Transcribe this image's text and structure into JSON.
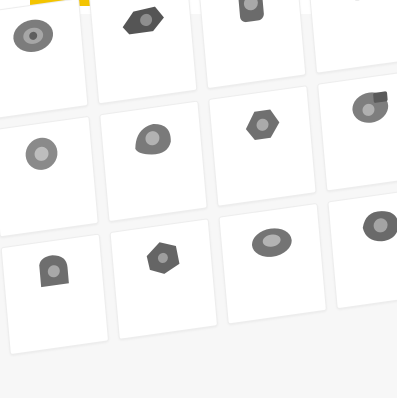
{
  "colors": {
    "accent": "#f3c400",
    "code_text": "#2b3b6c",
    "badge_text": "#2f8a2f",
    "badge_bg": "#e9f6e9",
    "desc_text": "#8a8a8a"
  },
  "products": [
    {
      "badge": "",
      "code": "",
      "desc": "",
      "button": "",
      "icon": "turbo-part-icon"
    },
    {
      "badge": "",
      "code": "",
      "desc": "",
      "button": "",
      "icon": "turbo-part-icon"
    },
    {
      "badge": "",
      "code": "",
      "desc": "",
      "button": "",
      "icon": "turbo-part-icon"
    },
    {
      "badge": "",
      "code": "",
      "desc": "",
      "button": "",
      "icon": "turbo-part-icon"
    },
    {
      "badge": "",
      "code": "",
      "desc": "",
      "button": "",
      "icon": "turbo-part-icon"
    },
    {
      "badge": "",
      "code": "",
      "desc": "",
      "button": "",
      "icon": "turbo-part-icon"
    },
    {
      "badge": "",
      "code": "",
      "desc": "",
      "button": "",
      "icon": "turbo-part-icon"
    },
    {
      "badge": "",
      "code": "",
      "desc": "",
      "button": "",
      "icon": "turbo-part-icon"
    },
    {
      "badge": "",
      "code": "",
      "desc": "",
      "button": "",
      "icon": "turbo-part-icon"
    },
    {
      "badge": "",
      "code": "",
      "desc": "",
      "button": "",
      "icon": "turbo-part-icon"
    },
    {
      "badge": "",
      "code": "",
      "desc": "",
      "button": "",
      "icon": "turbo-part-icon"
    },
    {
      "badge": "",
      "code": "",
      "desc": "",
      "button": "",
      "icon": "turbo-part-icon"
    }
  ]
}
